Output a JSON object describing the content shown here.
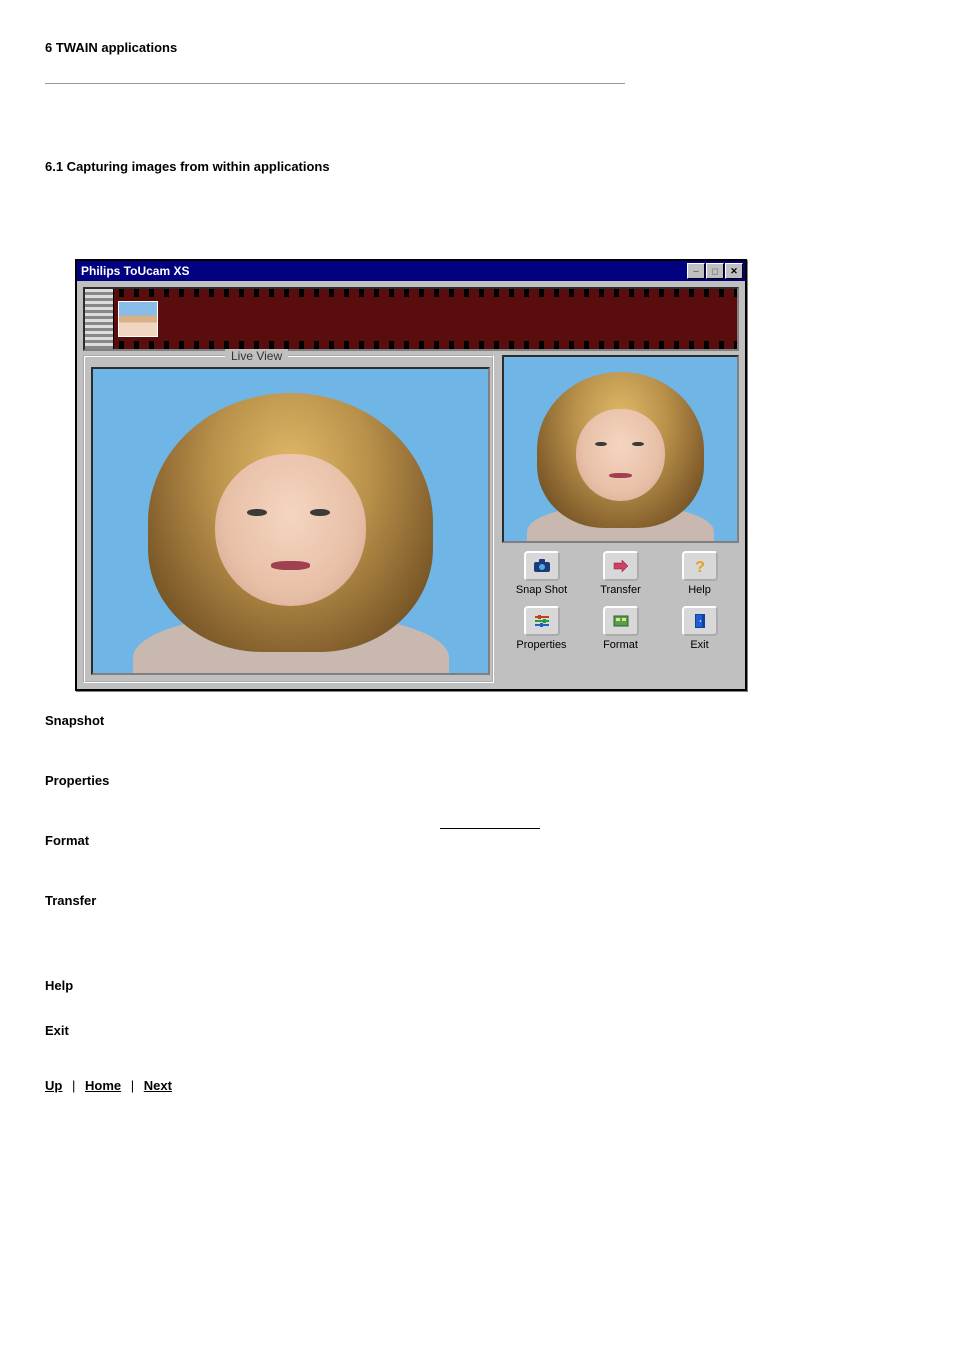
{
  "doc": {
    "h1": "6 TWAIN applications",
    "h2": "6.1 Capturing images from within applications"
  },
  "window": {
    "title": "Philips ToUcam XS",
    "live_view_label": "Live  View",
    "buttons": {
      "snapshot": "Snap Shot",
      "transfer": "Transfer",
      "help": "Help",
      "properties": "Properties",
      "format": "Format",
      "exit": "Exit"
    },
    "icons": {
      "snapshot": "camera-icon",
      "transfer": "transfer-icon",
      "help": "help-icon",
      "properties": "sliders-icon",
      "format": "format-icon",
      "exit": "door-icon"
    }
  },
  "sections": {
    "snapshot": "Snapshot",
    "properties": "Properties",
    "format": "Format",
    "transfer": "Transfer",
    "help": "Help",
    "exit": "Exit"
  },
  "nav": {
    "up": "Up",
    "home": "Home",
    "next": "Next",
    "sep": "|"
  }
}
